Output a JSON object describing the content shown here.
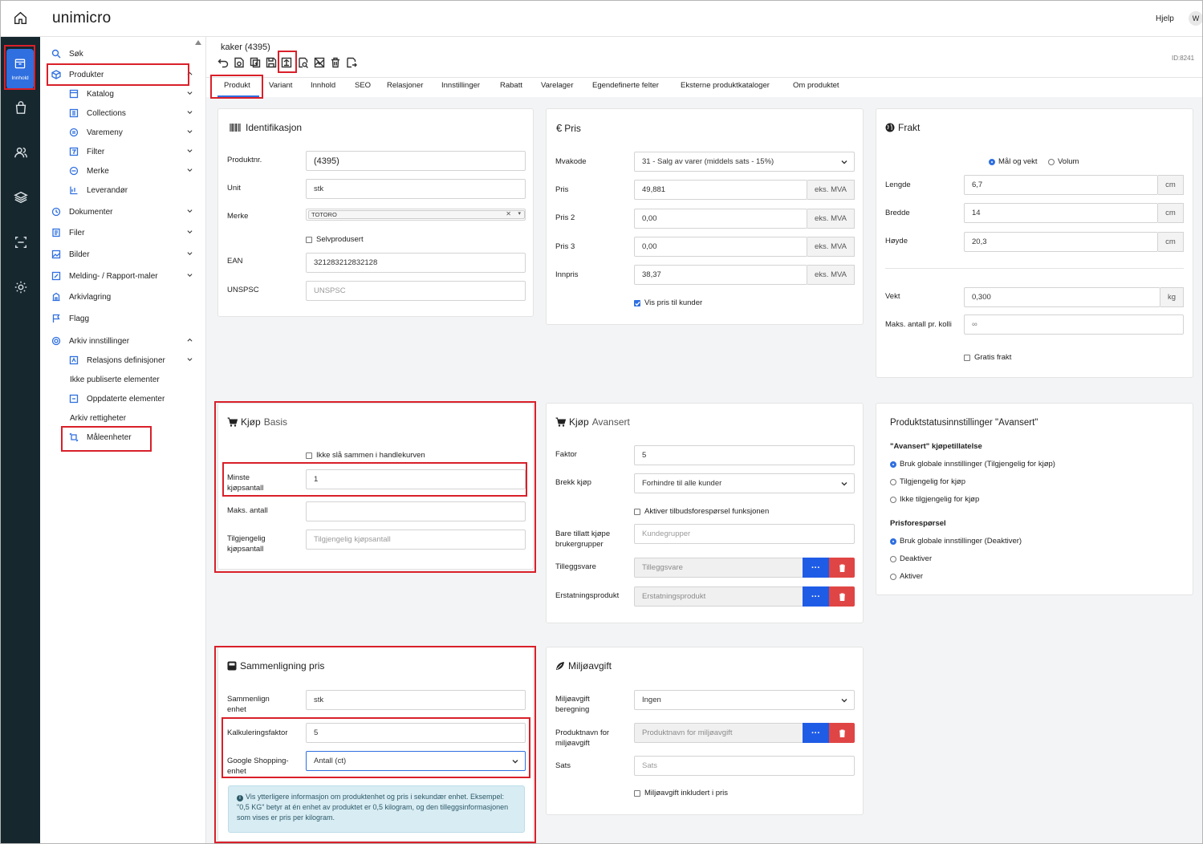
{
  "app": {
    "logo": "unimicro",
    "help": "Hjelp",
    "avatar": "W"
  },
  "rail": {
    "active_label": "Innhold"
  },
  "sidebar": {
    "items": [
      "Søk",
      "Produkter",
      "Katalog",
      "Collections",
      "Varemeny",
      "Filter",
      "Merke",
      "Leverandør",
      "Dokumenter",
      "Filer",
      "Bilder",
      "Melding- / Rapport-maler",
      "Arkivlagring",
      "Flagg",
      "Arkiv innstillinger",
      "Relasjons definisjoner",
      "Ikke publiserte elementer",
      "Oppdaterte elementer",
      "Arkiv rettigheter",
      "Måleenheter"
    ]
  },
  "header": {
    "title": "kaker (4395)",
    "id": "ID:8241"
  },
  "tabs": [
    "Produkt",
    "Variant",
    "Innhold",
    "SEO",
    "Relasjoner",
    "Innstillinger",
    "Rabatt",
    "Varelager",
    "Egendefinerte felter",
    "Eksterne produktkataloger",
    "Om produktet"
  ],
  "ident": {
    "title": "Identifikasjon",
    "productnr_label": "Produktnr.",
    "productnr": "(4395)",
    "unit_label": "Unit",
    "unit": "stk",
    "brand_label": "Merke",
    "brand": "TOTORO",
    "selfproduced": "Selvprodusert",
    "ean_label": "EAN",
    "ean": "321283212832128",
    "unspsc_label": "UNSPSC",
    "unspsc_ph": "UNSPSC"
  },
  "pris": {
    "title": "Pris",
    "mva_label": "Mvakode",
    "mva": "31 - Salg av varer (middels sats - 15%)",
    "pris_label": "Pris",
    "pris": "49,881",
    "pris2_label": "Pris 2",
    "pris2": "0,00",
    "pris3_label": "Pris 3",
    "pris3": "0,00",
    "innpris_label": "Innpris",
    "innpris": "38,37",
    "addon": "eks. MVA",
    "vis_pris": "Vis pris til kunder"
  },
  "frakt": {
    "title": "Frakt",
    "opt1": "Mål og vekt",
    "opt2": "Volum",
    "lengde_label": "Lengde",
    "lengde": "6,7",
    "bredde_label": "Bredde",
    "bredde": "14",
    "hoyde_label": "Høyde",
    "hoyde": "20,3",
    "cm": "cm",
    "vekt_label": "Vekt",
    "vekt": "0,300",
    "kg": "kg",
    "maks_label": "Maks. antall pr. kolli",
    "maks": "∞",
    "gratis": "Gratis frakt"
  },
  "kjop_basis": {
    "title": "Kjøp",
    "title2": "Basis",
    "ikke_sla": "Ikke slå sammen i handlekurven",
    "minste_label": "Minste kjøpsantall",
    "minste": "1",
    "maks_label": "Maks. antall",
    "maks": "",
    "tilgj_label": "Tilgjengelig kjøpsantall",
    "tilgj_ph": "Tilgjengelig kjøpsantall"
  },
  "kjop_avansert": {
    "title": "Kjøp",
    "title2": "Avansert",
    "faktor_label": "Faktor",
    "faktor": "5",
    "brekk_label": "Brekk kjøp",
    "brekk": "Forhindre til alle kunder",
    "aktiver": "Aktiver tilbudsforespørsel funksjonen",
    "bare_label": "Bare tillatt kjøpe brukergrupper",
    "bare_ph": "Kundegrupper",
    "tillegg_label": "Tilleggsvare",
    "tillegg_ph": "Tilleggsvare",
    "erstat_label": "Erstatningsprodukt",
    "erstat_ph": "Erstatningsprodukt",
    "dots": "···"
  },
  "status": {
    "title": "Produktstatusinnstillinger \"Avansert\"",
    "g1": "\"Avansert\" kjøpetillatelse",
    "g1o1": "Bruk globale innstillinger (Tilgjengelig for kjøp)",
    "g1o2": "Tilgjengelig for kjøp",
    "g1o3": "Ikke tilgjengelig for kjøp",
    "g2": "Prisforespørsel",
    "g2o1": "Bruk globale innstillinger (Deaktiver)",
    "g2o2": "Deaktiver",
    "g2o3": "Aktiver"
  },
  "sammen": {
    "title": "Sammenligning pris",
    "enhet_label": "Sammenlign enhet",
    "enhet": "stk",
    "kalk_label": "Kalkuleringsfaktor",
    "kalk": "5",
    "google_label": "Google Shopping-enhet",
    "google": "Antall (ct)",
    "info": "Vis ytterligere informasjon om produktenhet og pris i sekundær enhet. Eksempel: \"0,5 KG\" betyr at én enhet av produktet er 0,5 kilogram, og den tilleggsinformasjonen som vises er pris per kilogram."
  },
  "miljo": {
    "title": "Miljøavgift",
    "beregn_label": "Miljøavgift beregning",
    "beregn": "Ingen",
    "navn_label": "Produktnavn for miljøavgift",
    "navn_ph": "Produktnavn for miljøavgift",
    "sats_label": "Sats",
    "sats_ph": "Sats",
    "inkl": "Miljøavgift inkludert i pris",
    "dots": "···"
  }
}
